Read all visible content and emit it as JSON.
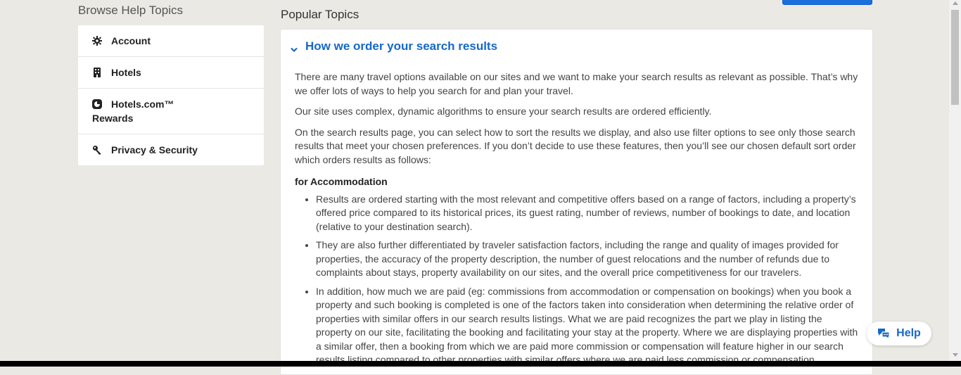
{
  "sidebar": {
    "title": "Browse Help Topics",
    "items": [
      {
        "label": "Account",
        "icon": "gear-icon"
      },
      {
        "label": "Hotels",
        "icon": "building-icon"
      },
      {
        "label": "Hotels.com™ Rewards",
        "label_line1": "Hotels.com™",
        "label_line2": "Rewards",
        "icon": "rewards-icon"
      },
      {
        "label": "Privacy & Security",
        "icon": "key-icon"
      }
    ]
  },
  "main": {
    "title": "Popular Topics",
    "article": {
      "heading": "How we order your search results",
      "paragraphs": [
        "There are many travel options available on our sites and we want to make your search results as relevant as possible. That’s why we offer lots of ways to help you search for and plan your travel.",
        "Our site uses complex, dynamic algorithms to ensure your search results are ordered efficiently.",
        "On the search results page, you can select how to sort the results we display, and also use filter options to see only those search results that meet your chosen preferences. If you don’t decide to use these features, then you’ll see our chosen default sort order which orders results as follows:"
      ],
      "subheading": "for Accommodation",
      "bullets": [
        "Results are ordered starting with the most relevant and competitive offers based on a range of factors, including a property’s offered price compared to its historical prices, its guest rating, number of reviews, number of bookings to date, and location (relative to your destination search).",
        "They are also further differentiated by traveler satisfaction factors, including the range and quality of images provided for properties, the accuracy of the property description, the number of guest relocations and the number of refunds due to complaints about stays, property availability on our sites, and the overall price competitiveness for our travelers.",
        "In addition, how much we are paid (eg: commissions from accommodation or compensation on bookings) when you book a property and such booking is completed is one of the factors taken into consideration when determining the relative order of properties with similar offers in our search results listings. What we are paid recognizes the part we play in listing the property on our site, facilitating the booking and facilitating your stay at the property. Where we are displaying properties with a similar offer, then a booking from which we are paid more commission or compensation will feature higher in our search results listing compared to other properties with similar offers where we are paid less commission or compensation."
      ]
    }
  },
  "help_button": {
    "label": "Help",
    "icon": "chat-icon"
  },
  "colors": {
    "accent": "#1668c9",
    "background": "#ebe9e4"
  }
}
